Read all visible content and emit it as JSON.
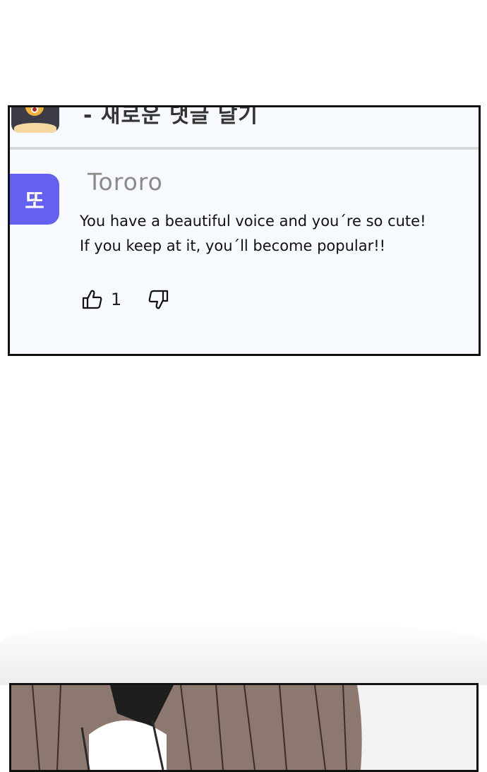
{
  "previous_comment": {
    "text": "- 새로운 댓글 달기"
  },
  "comment": {
    "avatar_char": "또",
    "avatar_color": "#6461f2",
    "username": "Tororo",
    "lines": [
      "You have a beautiful voice and you´re so cute!",
      "If you keep at it, you´ll become popular!!"
    ],
    "likes": "1",
    "like_icon": "thumbs-up-icon",
    "dislike_icon": "thumbs-down-icon"
  }
}
